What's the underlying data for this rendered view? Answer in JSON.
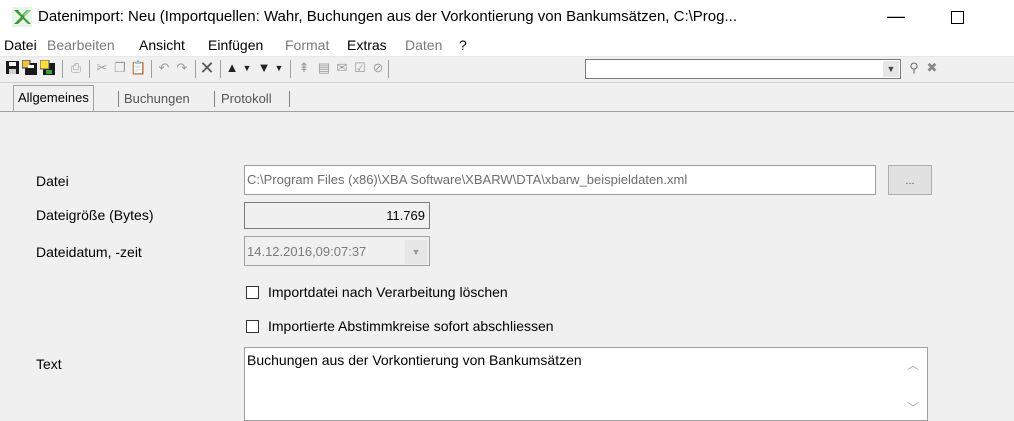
{
  "window": {
    "title": "Datenimport: Neu (Importquellen: Wahr, Buchungen aus der Vorkontierung von Bankumsätzen, C:\\Prog...",
    "minimize_glyph": "—"
  },
  "menu": {
    "items": [
      {
        "label": "Datei",
        "enabled": true
      },
      {
        "label": "Bearbeiten",
        "enabled": false
      },
      {
        "label": "Ansicht",
        "enabled": true
      },
      {
        "label": "Einfügen",
        "enabled": true
      },
      {
        "label": "Format",
        "enabled": false
      },
      {
        "label": "Extras",
        "enabled": true
      },
      {
        "label": "Daten",
        "enabled": false
      },
      {
        "label": "?",
        "enabled": true
      }
    ]
  },
  "toolbar": {
    "icons": [
      "save-icon",
      "save-as-icon",
      "save-all-icon",
      "print-icon",
      "cut-icon",
      "copy-icon",
      "paste-icon",
      "undo-icon",
      "redo-icon",
      "delete-icon",
      "move-up-icon",
      "move-down-icon",
      "filter-icon",
      "export-icon",
      "mail-icon",
      "check-icon",
      "stamp-icon",
      "search-icon",
      "close-filter-icon"
    ],
    "search_value": ""
  },
  "tabs": [
    {
      "label": "Allgemeines",
      "active": true
    },
    {
      "label": "Buchungen",
      "active": false
    },
    {
      "label": "Protokoll",
      "active": false
    }
  ],
  "form": {
    "datei_label": "Datei",
    "datei_value": "C:\\Program Files (x86)\\XBA Software\\XBARW\\DTA\\xbarw_beispieldaten.xml",
    "browse_label": "...",
    "groesse_label": "Dateigröße (Bytes)",
    "groesse_value": "11.769",
    "datum_label": "Dateidatum, -zeit",
    "datum_value": "14.12.2016,09:07:37",
    "chk_loeschen_label": "Importdatei nach Verarbeitung löschen",
    "chk_loeschen_checked": false,
    "chk_abschliessen_label": "Importierte Abstimmkreise sofort abschliessen",
    "chk_abschliessen_checked": false,
    "text_label": "Text",
    "text_value": "Buchungen aus der Vorkontierung von Bankumsätzen"
  },
  "colors": {
    "app_icon": "#3c9a3c",
    "titlebar_bg": "#ffffff",
    "window_bg": "#f0f0f0"
  }
}
